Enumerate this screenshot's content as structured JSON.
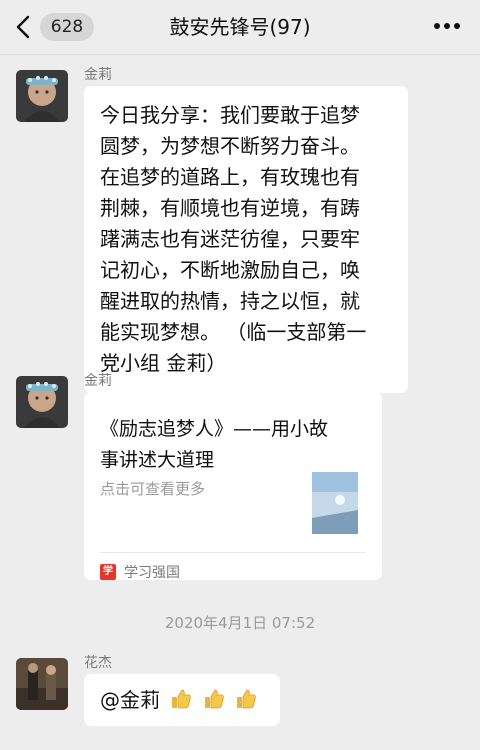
{
  "header": {
    "back_count": "628",
    "title": "鼓安先锋号(97)"
  },
  "messages": [
    {
      "sender": "金莉",
      "text": "今日我分享：我们要敢于追梦\n圆梦，为梦想不断努力奋斗。\n在追梦的道路上，有玫瑰也有\n荆棘，有顺境也有逆境，有踌\n躇满志也有迷茫彷徨，只要牢\n记初心，不断地激励自己，唤\n醒进取的热情，持之以恒，就\n能实现梦想。 （临一支部第一\n党小组   金莉）"
    },
    {
      "sender": "金莉",
      "card": {
        "title": "《励志追梦人》——用小故\n事讲述大道理",
        "subtitle": "点击可查看更多",
        "source": "学习强国"
      }
    }
  ],
  "timestamp": "2020年4月1日 07:52",
  "last_message": {
    "sender": "花杰",
    "text": "@金莉"
  }
}
